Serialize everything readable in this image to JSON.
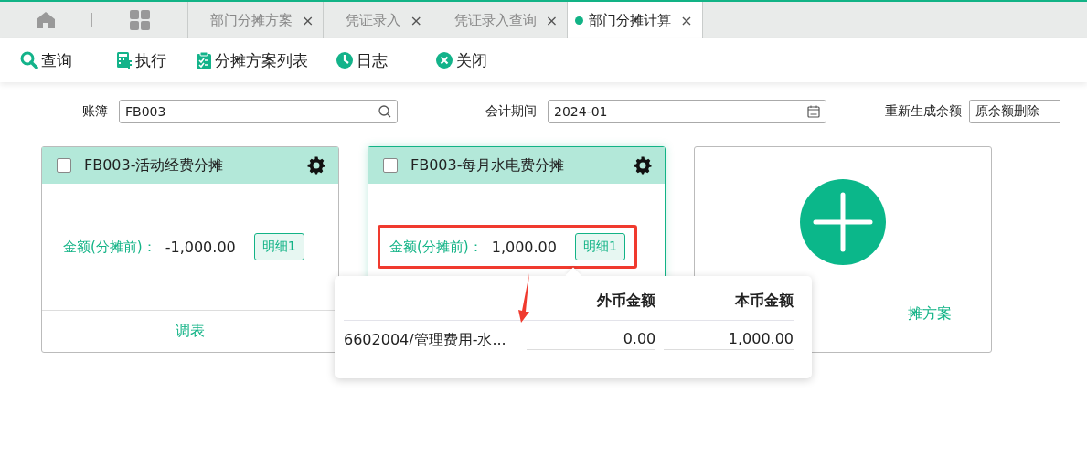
{
  "tabs": [
    {
      "label": "部门分摊方案",
      "selected": false
    },
    {
      "label": "凭证录入",
      "selected": false
    },
    {
      "label": "凭证录入查询",
      "selected": false
    },
    {
      "label": "部门分摊计算",
      "selected": true
    }
  ],
  "close_glyph": "×",
  "toolbar": [
    {
      "kind": "query",
      "label": "查询"
    },
    {
      "kind": "execute",
      "label": "执行"
    },
    {
      "kind": "list",
      "label": "分摊方案列表"
    },
    {
      "kind": "log",
      "label": "日志"
    },
    {
      "kind": "close",
      "label": "关闭"
    }
  ],
  "filters": {
    "ledger": {
      "label": "账簿",
      "value": "FB003"
    },
    "period": {
      "label": "会计期间",
      "value": "2024-01"
    },
    "regenerate": {
      "label": "重新生成余额",
      "value": "原余额删除"
    }
  },
  "cards": [
    {
      "title": "FB003-活动经费分摊",
      "checked": false,
      "selected": false,
      "highlighted": false,
      "amount_label": "金额(分摊前)：",
      "amount": "-1,000.00",
      "detail_button": "明细1",
      "footer": "调表"
    },
    {
      "title": "FB003-每月水电费分摊",
      "checked": false,
      "selected": true,
      "highlighted": true,
      "amount_label": "金额(分摊前)：",
      "amount": "1,000.00",
      "detail_button": "明细1"
    }
  ],
  "add_card": {
    "label": "摊方案"
  },
  "popover": {
    "columns": [
      "外币金额",
      "本币金额"
    ],
    "rows": [
      {
        "account": "6602004/管理费用-水...",
        "foreign": "0.00",
        "local": "1,000.00"
      }
    ]
  }
}
